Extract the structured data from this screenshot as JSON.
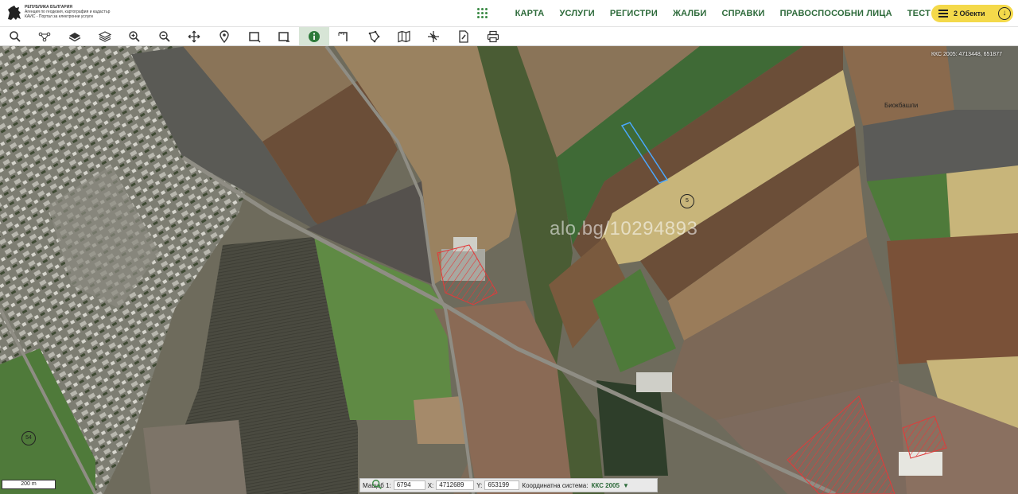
{
  "header": {
    "org_line1": "РЕПУБЛИКА БЪЛГАРИЯ",
    "org_line2": "Агенция по геодезия, картография и кадастър",
    "org_line3": "КАИС - Портал за електронни услуги",
    "logo_icon": "lion-emblem-icon"
  },
  "nav": {
    "grid_icon": "apps-grid-icon",
    "items": [
      "КАРТА",
      "УСЛУГИ",
      "РЕГИСТРИ",
      "ЖАЛБИ",
      "СПРАВКИ",
      "ПРАВОСПОСОБНИ ЛИЦА",
      "ТЕСТ"
    ]
  },
  "objects": {
    "label": "2 Обекти",
    "menu_icon": "hamburger-icon",
    "download_icon": "download-icon"
  },
  "toolbar": {
    "tools": [
      "search-icon",
      "network-icon",
      "layers-icon",
      "layers-stack-icon",
      "zoom-in-icon",
      "zoom-out-icon",
      "pan-icon",
      "location-pin-icon",
      "select-rect-icon",
      "select-rect-add-icon",
      "info-icon",
      "measure-line-icon",
      "draw-polygon-icon",
      "map-icon",
      "crop-icon",
      "edit-doc-icon",
      "print-icon"
    ],
    "active": "info-icon",
    "accent": "#3a8a44"
  },
  "map": {
    "corner_coords": "ККС 2005: 4713448, 651877",
    "watermark": "alo.bg/10294893",
    "place_name": "Биокбашли",
    "markers": [
      "5",
      "54"
    ],
    "scale_label": "200 m",
    "hatch_color": "#e23a3a",
    "selection_color": "#4aa8ff"
  },
  "status": {
    "scale_label": "Мащаб 1:",
    "scale_value": "6794",
    "x_label": "X:",
    "x_value": "4712689",
    "y_label": "Y:",
    "y_value": "653199",
    "system_label": "Координатна система:",
    "system_value": "ККС 2005",
    "dropdown_icon": "triangle-down-icon",
    "search_icon": "magnifier-icon"
  }
}
